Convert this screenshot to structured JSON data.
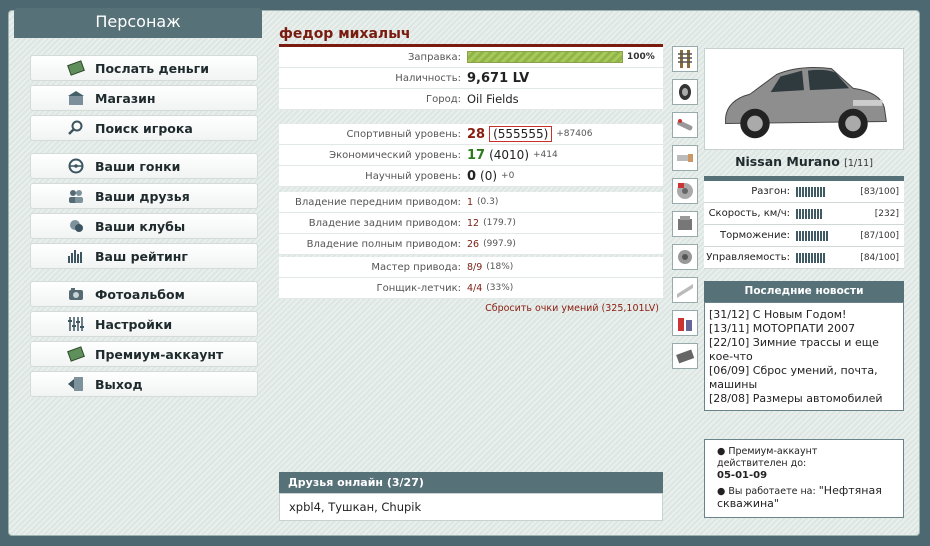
{
  "header": {
    "title": "Персонаж"
  },
  "menu": {
    "groups": [
      [
        {
          "label": "Послать деньги",
          "icon": "money-icon"
        },
        {
          "label": "Магазин",
          "icon": "shop-icon"
        },
        {
          "label": "Поиск игрока",
          "icon": "search-icon"
        }
      ],
      [
        {
          "label": "Ваши гонки",
          "icon": "steering-wheel-icon"
        },
        {
          "label": "Ваши друзья",
          "icon": "friends-icon"
        },
        {
          "label": "Ваши клубы",
          "icon": "clubs-icon"
        },
        {
          "label": "Ваш рейтинг",
          "icon": "rating-icon"
        }
      ],
      [
        {
          "label": "Фотоальбом",
          "icon": "photo-icon"
        },
        {
          "label": "Настройки",
          "icon": "settings-icon"
        },
        {
          "label": "Премиум-аккаунт",
          "icon": "premium-icon"
        },
        {
          "label": "Выход",
          "icon": "exit-icon"
        }
      ]
    ]
  },
  "profile": {
    "name": "федор михалыч",
    "fuel_label": "Заправка:",
    "fuel_value": "100%",
    "fuel_fraction": 1.0,
    "cash_label": "Наличность:",
    "cash_value": "9,671 LV",
    "city_label": "Город:",
    "city_value": "Oil Fields",
    "sport_label": "Спортивный уровень:",
    "sport_level": "28",
    "sport_points": "(555555)",
    "sport_delta": "+87406",
    "econ_label": "Экономический уровень:",
    "econ_level": "17",
    "econ_points": "(4010)",
    "econ_delta": "+414",
    "sci_label": "Научный уровень:",
    "sci_level": "0",
    "sci_points": "(0)",
    "sci_delta": "+0",
    "fwd_label": "Владение передним приводом:",
    "fwd_level": "1",
    "fwd_points": "(0.3)",
    "rwd_label": "Владение задним приводом:",
    "rwd_level": "12",
    "rwd_points": "(179.7)",
    "awd_label": "Владение полным приводом:",
    "awd_level": "26",
    "awd_points": "(997.9)",
    "master_label": "Мастер привода:",
    "master_value": "8/9",
    "master_pct": "(18%)",
    "pilot_label": "Гонщик-летчик:",
    "pilot_value": "4/4",
    "pilot_pct": "(33%)",
    "reset_label": "Сбросить очки умений (325,101LV)"
  },
  "friends": {
    "header": "Друзья онлайн (3/27)",
    "list": "xpbl4, Тушкан, Chupik"
  },
  "parts": [
    "suspension-icon",
    "tire-icon",
    "exhaust-icon",
    "intake-icon",
    "brake-disc-icon",
    "engine-icon",
    "turbo-icon",
    "body-panel-icon",
    "fluids-icon",
    "chassis-icon"
  ],
  "car": {
    "name": "Nissan Murano",
    "count": "[1/11]",
    "stats": [
      {
        "label": "Разгон:",
        "value": "[83/100]",
        "level": 0.83
      },
      {
        "label": "Скорость, км/ч:",
        "value": "[232]",
        "level": 0.7
      },
      {
        "label": "Торможение:",
        "value": "[87/100]",
        "level": 0.87
      },
      {
        "label": "Управляемость:",
        "value": "[84/100]",
        "level": 0.84
      }
    ],
    "body_color": "#8e8e8e"
  },
  "news": {
    "header": "Последние новости",
    "items": [
      "[31/12] С Новым Годом!",
      "[13/11] МОТОРПАТИ 2007",
      "[22/10] Зимние трассы и еще кое-что",
      "[06/09] Сброс умений, почта, машины",
      "[28/08] Размеры автомобилей"
    ]
  },
  "premium": {
    "line1": "Премиум-аккаунт действителен до:",
    "date": "05-01-09",
    "line2_prefix": "Вы работаете на:",
    "job": "\"Нефтяная скважина\""
  },
  "colors": {
    "accent": "#567178",
    "name_red": "#7a1b10",
    "green": "#2d7a1c"
  }
}
